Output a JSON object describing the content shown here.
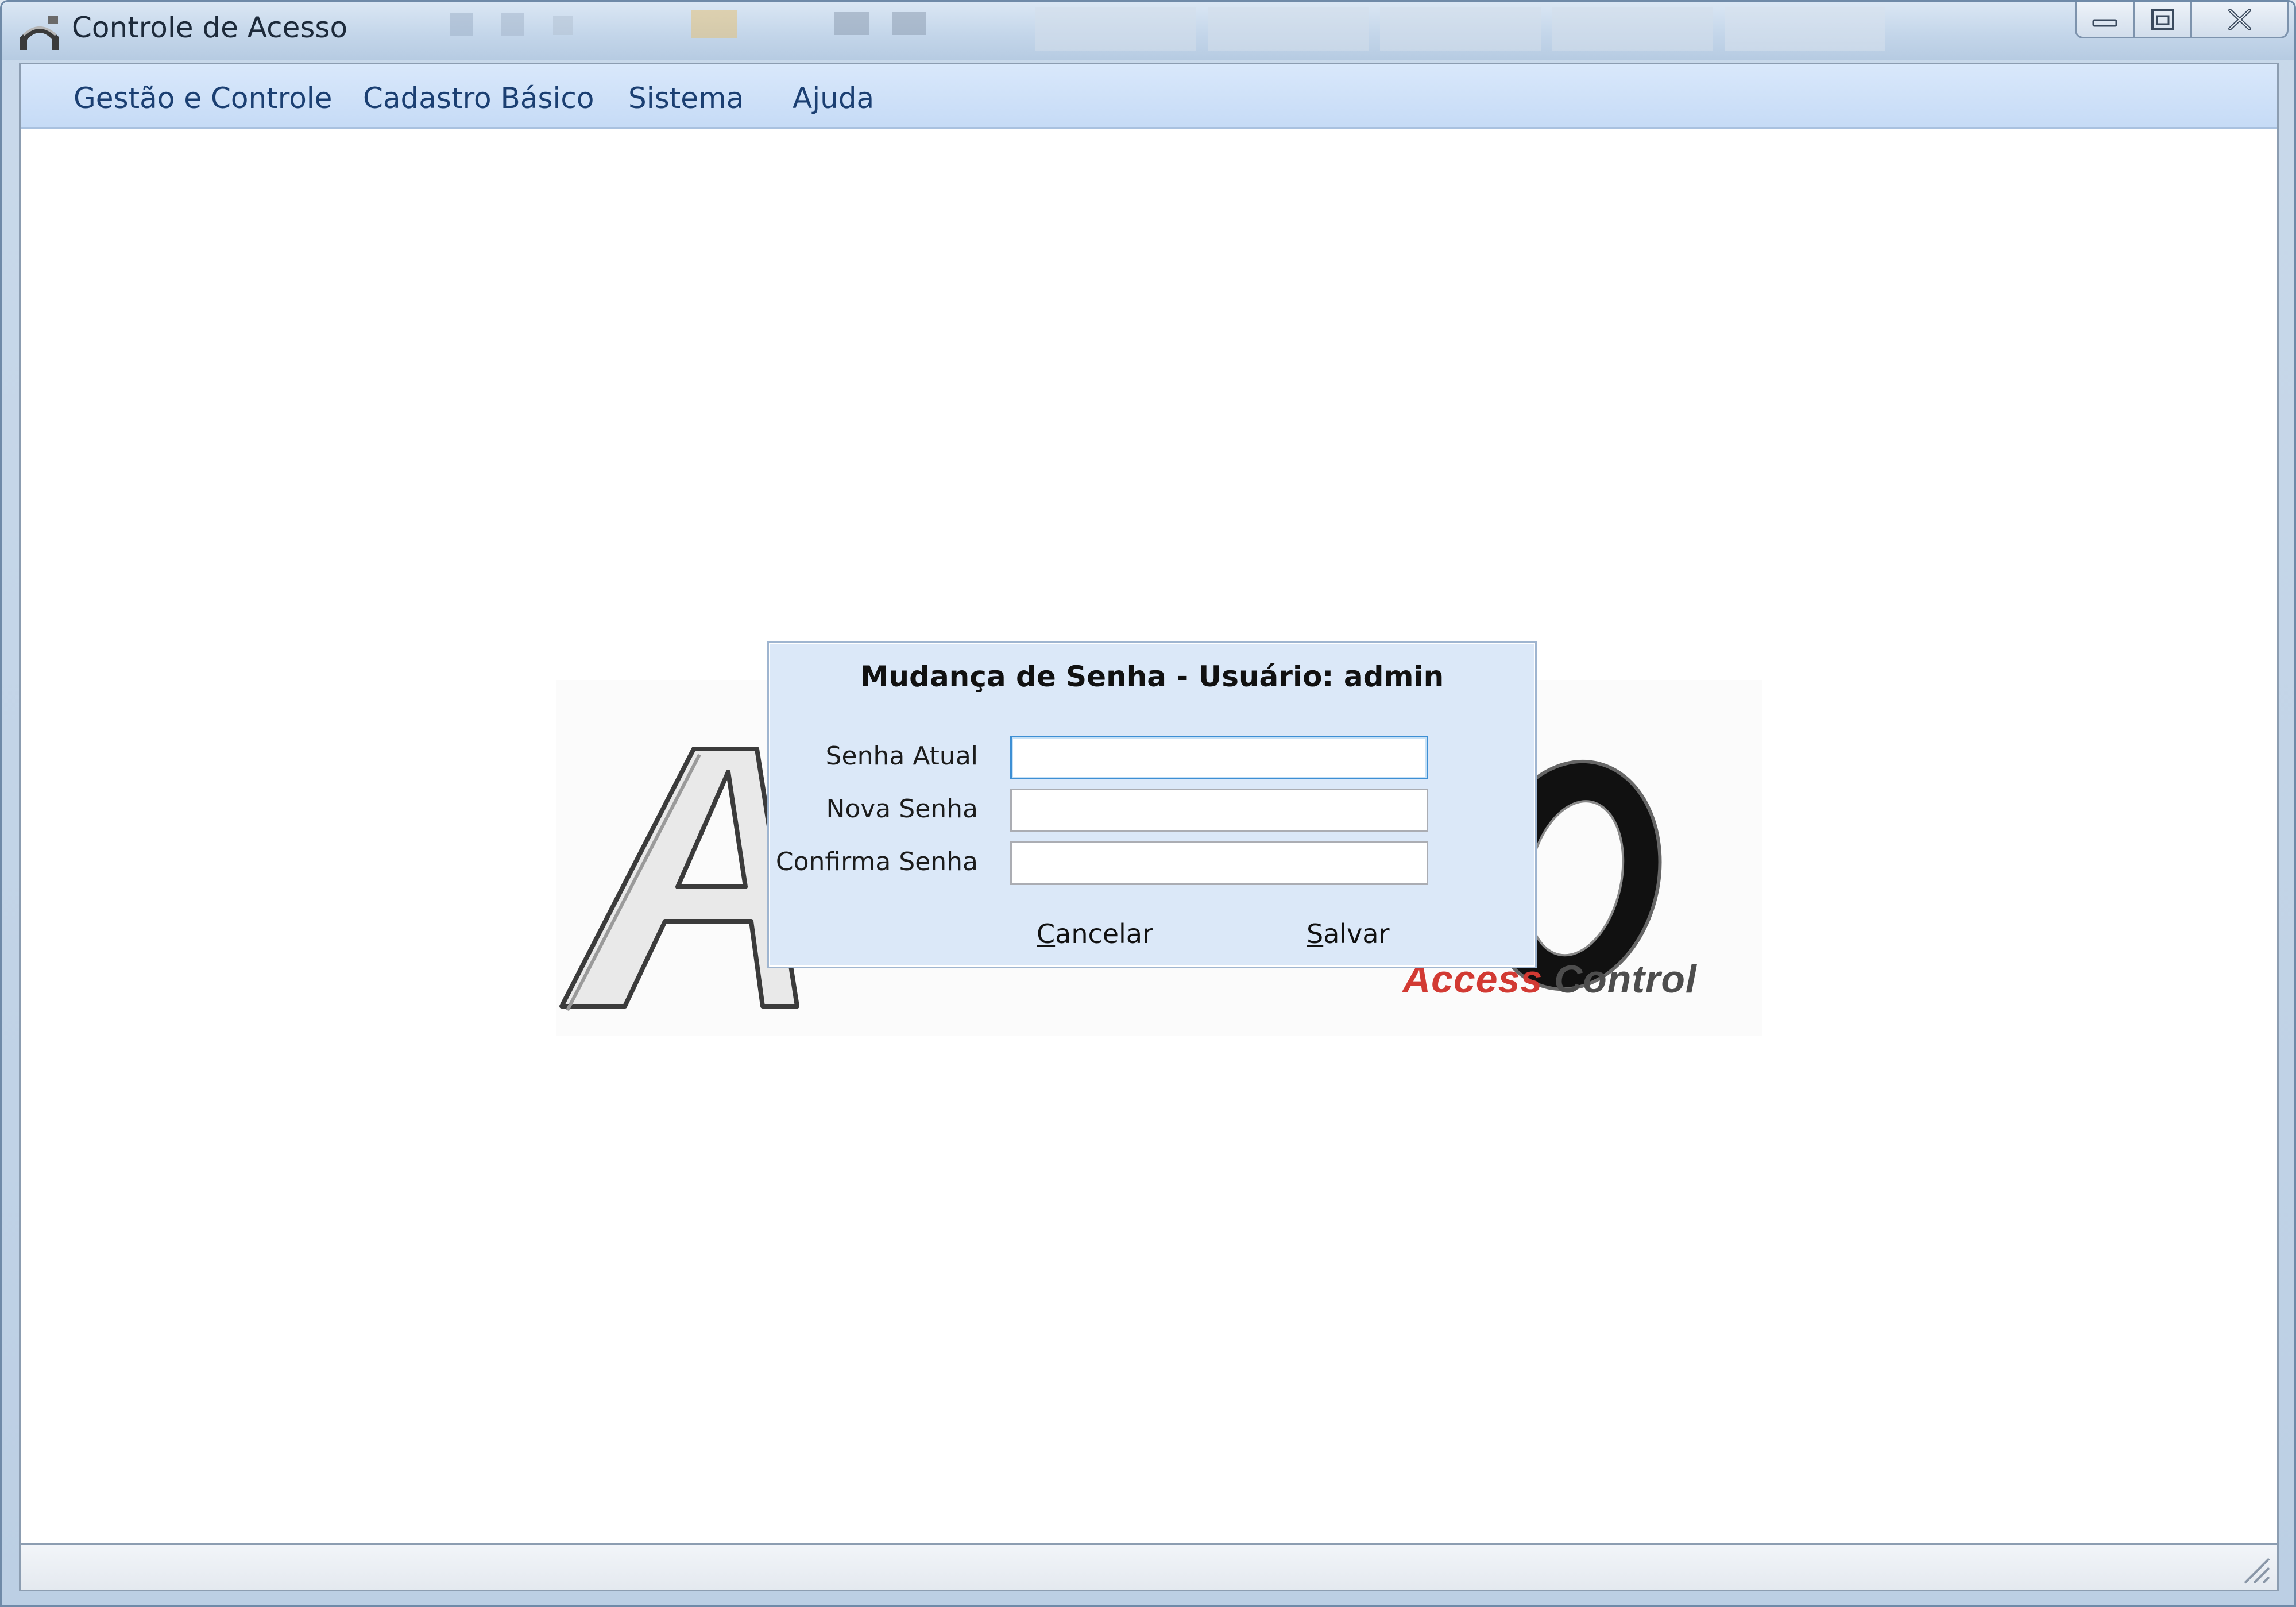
{
  "window": {
    "title": "Controle de Acesso"
  },
  "menu": {
    "items": [
      "Gestão e Controle",
      "Cadastro Básico",
      "Sistema",
      "Ajuda"
    ]
  },
  "logo": {
    "tagline_red": "Access",
    "tagline_gray": "Control"
  },
  "dialog": {
    "title": "Mudança de Senha - Usuário: admin",
    "fields": [
      {
        "label": "Senha Atual",
        "value": ""
      },
      {
        "label": "Nova Senha",
        "value": ""
      },
      {
        "label": "Confirma Senha",
        "value": ""
      }
    ],
    "cancel": {
      "mnemonic": "C",
      "rest": "ancelar"
    },
    "save": {
      "mnemonic": "S",
      "rest": "alvar"
    }
  },
  "colors": {
    "menubar": "#c6dbf6",
    "menu_text": "#1b3f72",
    "dialog_bg": "#dbe8f8",
    "logo_red": "#d23a33",
    "focus_border": "#3d8fd4"
  },
  "icons": [
    "app-icon",
    "minimize-icon",
    "maximize-icon",
    "close-icon",
    "resize-grip-icon"
  ]
}
